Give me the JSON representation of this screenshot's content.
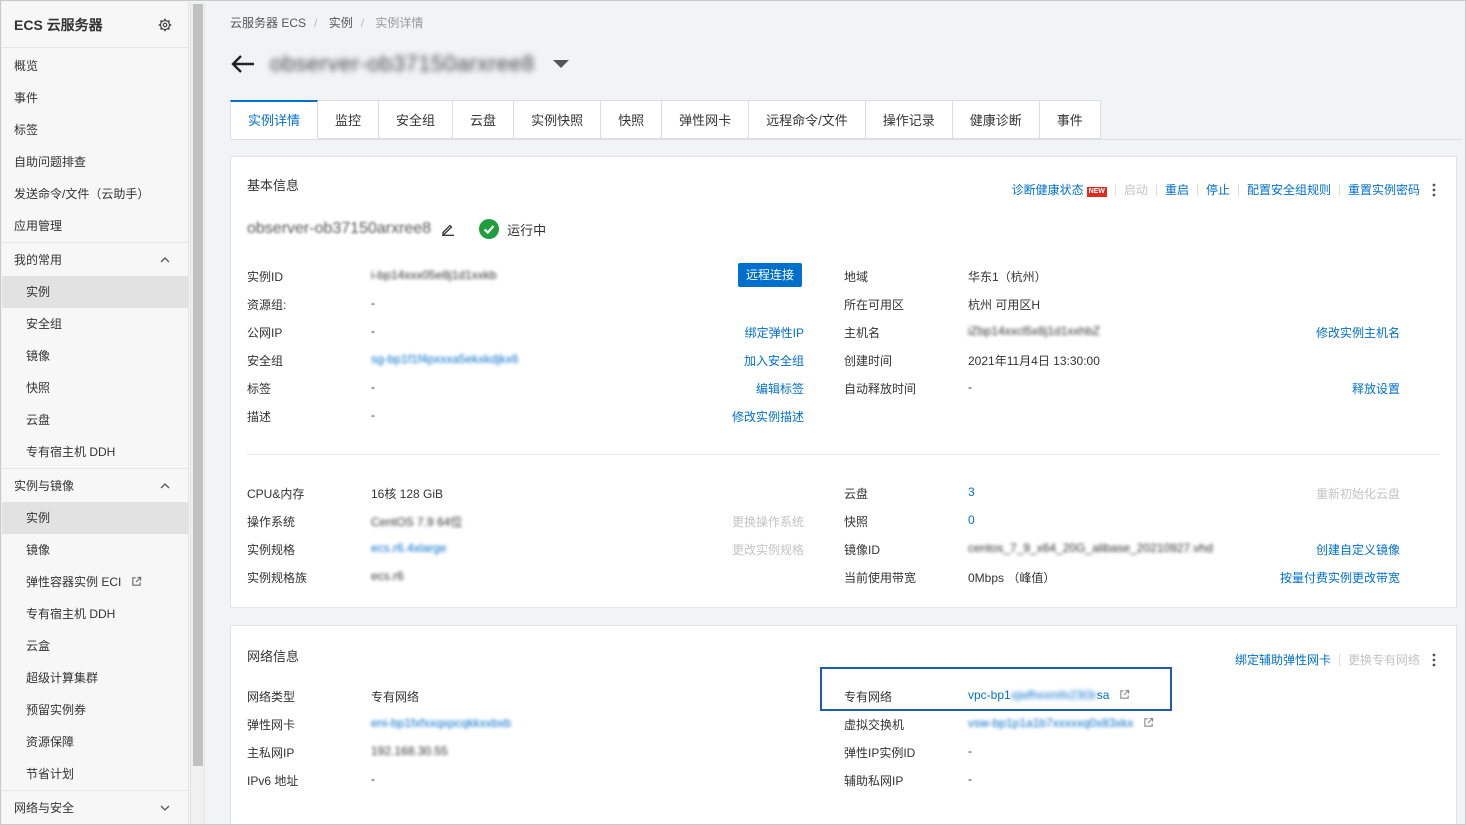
{
  "sidebar": {
    "title": "ECS 云服务器",
    "items": [
      {
        "label": "概览"
      },
      {
        "label": "事件"
      },
      {
        "label": "标签"
      },
      {
        "label": "自助问题排查"
      },
      {
        "label": "发送命令/文件（云助手）"
      },
      {
        "label": "应用管理"
      }
    ],
    "group_common": {
      "label": "我的常用",
      "items": [
        "实例",
        "安全组",
        "镜像",
        "快照",
        "云盘",
        "专有宿主机 DDH"
      ]
    },
    "group_instances": {
      "label": "实例与镜像",
      "items": [
        "实例",
        "镜像",
        "弹性容器实例 ECI",
        "专有宿主机 DDH",
        "云盒",
        "超级计算集群",
        "预留实例券",
        "资源保障",
        "节省计划"
      ]
    },
    "group_network": {
      "label": "网络与安全"
    }
  },
  "breadcrumb": [
    "云服务器 ECS",
    "实例",
    "实例详情"
  ],
  "page_title": "observer-ob37150arxree8",
  "tabs": [
    "实例详情",
    "监控",
    "安全组",
    "云盘",
    "实例快照",
    "快照",
    "弹性网卡",
    "远程命令/文件",
    "操作记录",
    "健康诊断",
    "事件"
  ],
  "basic": {
    "title": "基本信息",
    "actions": {
      "diagnose": "诊断健康状态",
      "new": "NEW",
      "start": "启动",
      "restart": "重启",
      "stop": "停止",
      "sg_rules": "配置安全组规则",
      "reset_pwd": "重置实例密码"
    },
    "instance_name": "observer-ob37150arxree8",
    "status": "运行中",
    "left_rows": [
      {
        "label": "实例ID",
        "value": "i-bp14xxx05e8j1d1xxkb",
        "action": ""
      },
      {
        "label": "资源组:",
        "value": "-",
        "action": ""
      },
      {
        "label": "公网IP",
        "value": "-",
        "action": "绑定弹性IP"
      },
      {
        "label": "安全组",
        "value": "sg-bp1f1f4pxxxa5ekxkdjkx6",
        "action": "加入安全组"
      },
      {
        "label": "标签",
        "value": "-",
        "action": "编辑标签"
      },
      {
        "label": "描述",
        "value": "-",
        "action": "修改实例描述"
      }
    ],
    "remote_connect": "远程连接",
    "right_rows": [
      {
        "label": "地域",
        "value": "华东1（杭州）",
        "action": ""
      },
      {
        "label": "所在可用区",
        "value": "杭州 可用区H",
        "action": ""
      },
      {
        "label": "主机名",
        "value": "iZbp14xxcl5x8j1d1xxhbZ",
        "action": "修改实例主机名"
      },
      {
        "label": "创建时间",
        "value": "2021年11月4日 13:30:00",
        "action": ""
      },
      {
        "label": "自动释放时间",
        "value": "-",
        "action": "释放设置"
      }
    ],
    "spec_left": [
      {
        "label": "CPU&内存",
        "value": "16核 128 GiB",
        "action": ""
      },
      {
        "label": "操作系统",
        "value": "CentOS 7.9 64位",
        "action": "更换操作系统"
      },
      {
        "label": "实例规格",
        "value": "ecs.r6.4xlarge",
        "action": "更改实例规格"
      },
      {
        "label": "实例规格族",
        "value": "ecs.r6",
        "action": ""
      }
    ],
    "spec_right": [
      {
        "label": "云盘",
        "value": "3",
        "action": "重新初始化云盘"
      },
      {
        "label": "快照",
        "value": "0",
        "action": ""
      },
      {
        "label": "镜像ID",
        "value": "centos_7_9_x64_20G_alibase_20210927.vhd",
        "action": "创建自定义镜像"
      },
      {
        "label": "当前使用带宽",
        "value": "0Mbps （峰值）",
        "action": "按量付费实例更改带宽"
      }
    ]
  },
  "network": {
    "title": "网络信息",
    "actions": {
      "bind_eni": "绑定辅助弹性网卡",
      "change_vpc": "更换专有网络"
    },
    "left_rows": [
      {
        "label": "网络类型",
        "value": "专有网络"
      },
      {
        "label": "弹性网卡",
        "value": "eni-bp1fxfxxqxpcqkkxxbxb"
      },
      {
        "label": "主私网IP",
        "value": "192.168.30.55"
      },
      {
        "label": "IPv6 地址",
        "value": "-"
      }
    ],
    "right_rows": [
      {
        "label": "专有网络",
        "value_prefix": "vpc-bp1",
        "value_blur": "xjwfhxxmfx23t3r",
        "value_suffix": "sa"
      },
      {
        "label": "虚拟交换机",
        "value": "vsw-bp1p1a1b7xxxxxq0x83xkx"
      },
      {
        "label": "弹性IP实例ID",
        "value": "-"
      },
      {
        "label": "辅助私网IP",
        "value": "-"
      }
    ]
  },
  "colors": {
    "link": "#0070cc",
    "primary": "#0070cc",
    "success": "#1e9e3e",
    "highlight": "#1f5bb5"
  }
}
